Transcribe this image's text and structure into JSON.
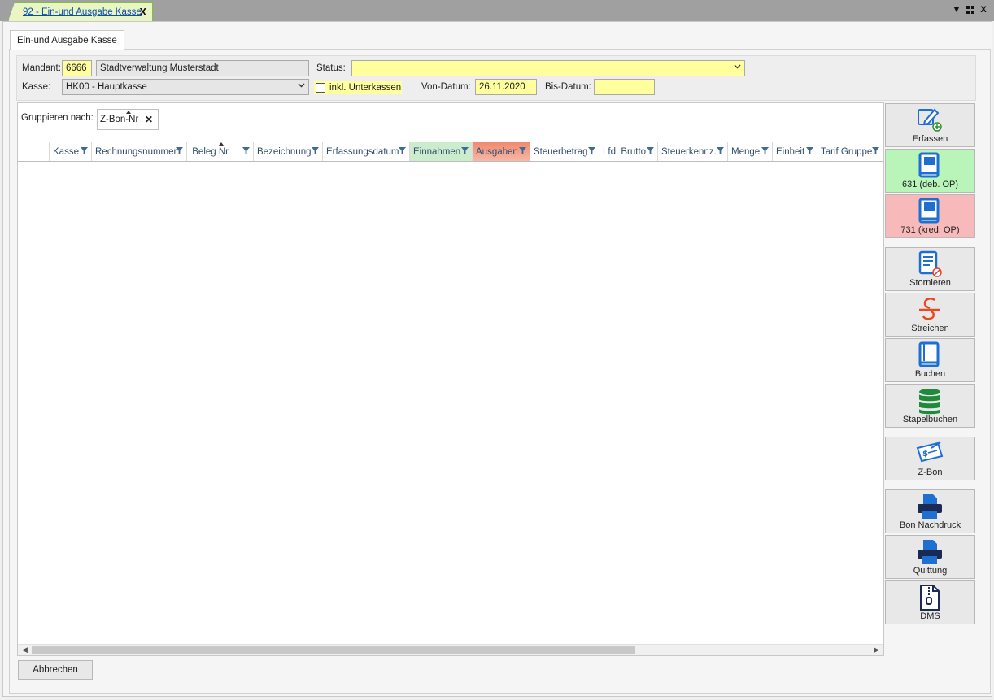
{
  "doc_tab": {
    "title": "92 - Ein-und Ausgabe Kasse",
    "close": "X"
  },
  "window_controls": {
    "dropdown": "▼",
    "layout": "⠿",
    "close": "X"
  },
  "inner_tab": {
    "label": "Ein-und Ausgabe Kasse"
  },
  "form": {
    "mandant_label": "Mandant:",
    "mandant_code": "6666",
    "mandant_name": "Stadtverwaltung Musterstadt",
    "status_label": "Status:",
    "status_value": "",
    "kasse_label": "Kasse:",
    "kasse_value": "HK00 - Hauptkasse",
    "unterkassen_label": "inkl. Unterkassen",
    "unterkassen_checked": false,
    "von_label": "Von-Datum:",
    "von_value": "26.11.2020",
    "bis_label": "Bis-Datum:",
    "bis_value": ""
  },
  "grid": {
    "group_label": "Gruppieren nach:",
    "group_chip": "Z-Bon-Nr",
    "columns": [
      {
        "label": "Kasse"
      },
      {
        "label": "Rechnungsnummer"
      },
      {
        "label": "Beleg Nr"
      },
      {
        "label": "Bezeichnung"
      },
      {
        "label": "Erfassungsdatum"
      },
      {
        "label": "Einnahmen",
        "color": "#cdeccd"
      },
      {
        "label": "Ausgaben",
        "color": "#f08a70"
      },
      {
        "label": "Steuerbetrag"
      },
      {
        "label": "Lfd. Brutto"
      },
      {
        "label": "Steuerkennz."
      },
      {
        "label": "Menge"
      },
      {
        "label": "Einheit"
      },
      {
        "label": "Tarif Gruppe"
      }
    ],
    "rows": []
  },
  "buttons": {
    "erfassen": {
      "label": "Erfassen",
      "icon": "pen-plus-icon"
    },
    "deb_op": {
      "label": "631 (deb. OP)",
      "icon": "book-icon",
      "color": "#b9f5b9"
    },
    "kred_op": {
      "label": "731 (kred. OP)",
      "icon": "book-icon",
      "color": "#f7b9b9"
    },
    "stornieren": {
      "label": "Stornieren",
      "icon": "book-cancel-icon"
    },
    "streichen": {
      "label": "Streichen",
      "icon": "strikethrough-icon"
    },
    "buchen": {
      "label": "Buchen",
      "icon": "book-icon"
    },
    "stapelbuchen": {
      "label": "Stapelbuchen",
      "icon": "database-icon"
    },
    "zbon": {
      "label": "Z-Bon",
      "icon": "cheque-icon"
    },
    "bon_nachdruck": {
      "label": "Bon Nachdruck",
      "icon": "printer-icon"
    },
    "quittung": {
      "label": "Quittung",
      "icon": "printer-icon"
    },
    "dms": {
      "label": "DMS",
      "icon": "zip-file-icon"
    },
    "abbrechen": {
      "label": "Abbrechen"
    }
  },
  "colors": {
    "yellow_field": "#ffff9e",
    "accent_blue": "#1f6fd1",
    "einnahmen": "#cdeccd",
    "ausgaben": "#f08a70"
  }
}
